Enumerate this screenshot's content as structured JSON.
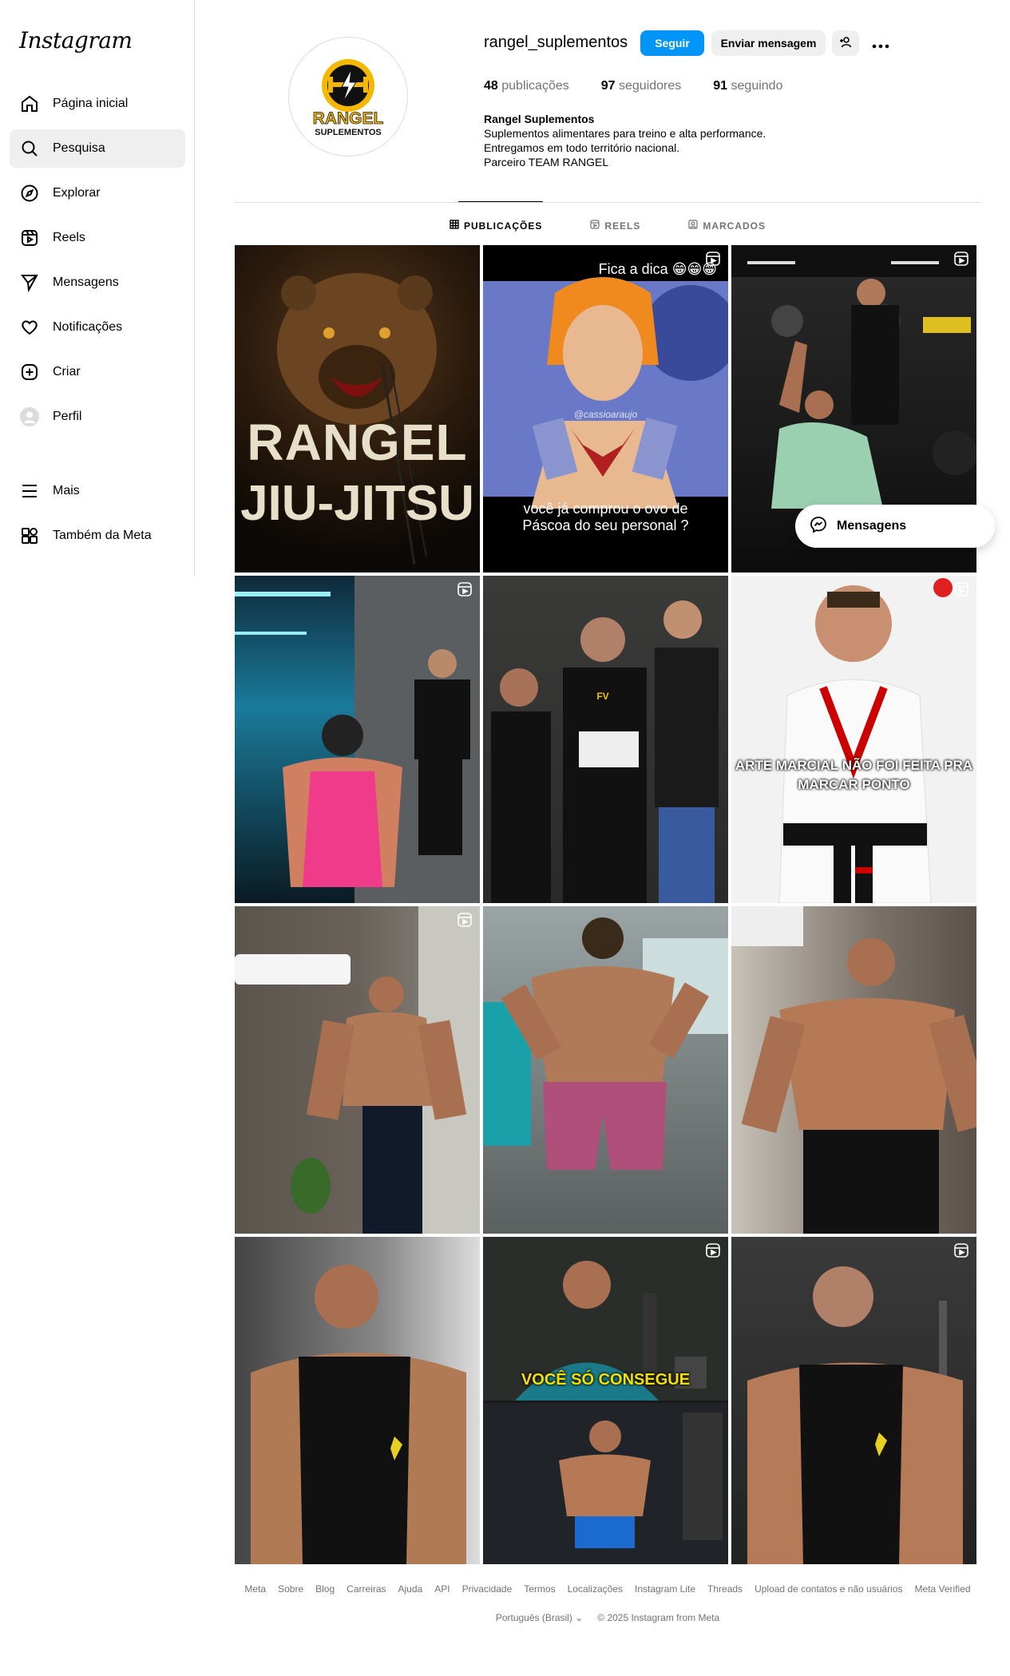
{
  "app": {
    "logo": "Instagram"
  },
  "sidebar": {
    "items": [
      {
        "label": "Página inicial",
        "icon": "home-icon"
      },
      {
        "label": "Pesquisa",
        "icon": "search-icon"
      },
      {
        "label": "Explorar",
        "icon": "compass-icon"
      },
      {
        "label": "Reels",
        "icon": "reels-icon"
      },
      {
        "label": "Mensagens",
        "icon": "paper-plane-icon"
      },
      {
        "label": "Notificações",
        "icon": "heart-icon"
      },
      {
        "label": "Criar",
        "icon": "plus-square-icon"
      },
      {
        "label": "Perfil",
        "icon": "avatar-icon"
      }
    ],
    "bottom": [
      {
        "label": "Mais",
        "icon": "menu-icon"
      },
      {
        "label": "Também da Meta",
        "icon": "meta-apps-icon"
      }
    ],
    "active_index": 1
  },
  "profile": {
    "username": "rangel_suplementos",
    "follow_label": "Seguir",
    "message_label": "Enviar mensagem",
    "stats": {
      "posts_num": "48",
      "posts_label": "publicações",
      "followers_num": "97",
      "followers_label": "seguidores",
      "following_num": "91",
      "following_label": "seguindo"
    },
    "bio": {
      "name": "Rangel Suplementos",
      "line1": "Suplementos alimentares para treino e alta performance.",
      "line2": "Entregamos em todo território nacional.",
      "line3": "Parceiro TEAM RANGEL"
    },
    "logo_text_1": "RANGEL",
    "logo_text_2": "SUPLEMENTOS"
  },
  "tabs": [
    {
      "label": "PUBLICAÇÕES",
      "icon": "grid-icon"
    },
    {
      "label": "REELS",
      "icon": "reels-icon"
    },
    {
      "label": "MARCADOS",
      "icon": "tagged-icon"
    }
  ],
  "posts": {
    "p1_line1": "RANGEL",
    "p1_line2": "JIU-JITSU",
    "p2_top": "Fica a dica 😁😁😁",
    "p2_watermark": "@cassioaraujo",
    "p2_bottom_1": "você já comprou o ovo de",
    "p2_bottom_2": "Páscoa do seu personal ?",
    "p6_caption_1": "ARTE MARCIAL NÃO FOI FEITA PRA",
    "p6_caption_2": "MARCAR PONTO",
    "p11_caption": "VOCÊ SÓ CONSEGUE"
  },
  "messages_bubble": {
    "label": "Mensagens"
  },
  "footer": {
    "links": [
      "Meta",
      "Sobre",
      "Blog",
      "Carreiras",
      "Ajuda",
      "API",
      "Privacidade",
      "Termos",
      "Localizações",
      "Instagram Lite",
      "Threads",
      "Upload de contatos e não usuários",
      "Meta Verified"
    ],
    "language": "Português (Brasil)",
    "copyright": "© 2025 Instagram from Meta"
  },
  "colors": {
    "accent": "#0095f6",
    "muted": "#737373",
    "border": "#dbdbdb"
  }
}
